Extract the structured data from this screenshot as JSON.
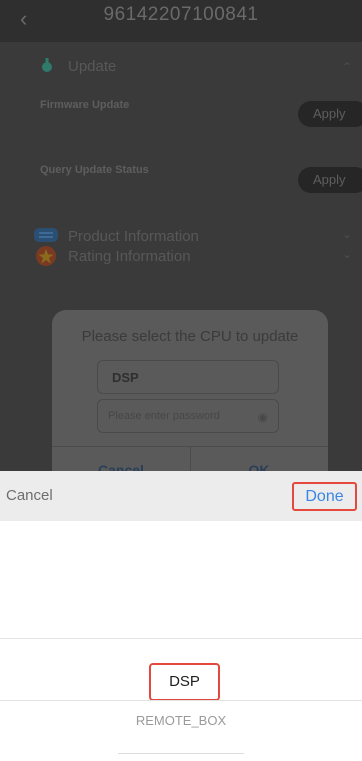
{
  "header": {
    "title": "96142207100841",
    "back_icon": "chevron-left-icon"
  },
  "update_section": {
    "label": "Update",
    "icon": "update-icon",
    "rows": [
      {
        "label": "Firmware Update",
        "button": "Apply"
      },
      {
        "label": "Query Update Status",
        "button": "Apply"
      }
    ]
  },
  "product_section": {
    "label": "Product Information",
    "icon": "product-icon"
  },
  "rating_section": {
    "label": "Rating Information",
    "icon": "rating-icon"
  },
  "dialog": {
    "title": "Please select the CPU to update",
    "cpu_value": "DSP",
    "password_placeholder": "Please enter password",
    "cancel": "Cancel",
    "ok": "OK"
  },
  "picker": {
    "cancel": "Cancel",
    "done": "Done",
    "options": [
      "DSP",
      "REMOTE_BOX"
    ],
    "selected": "DSP"
  },
  "colors": {
    "accent": "#3a86e6",
    "highlight": "#e5483d"
  }
}
